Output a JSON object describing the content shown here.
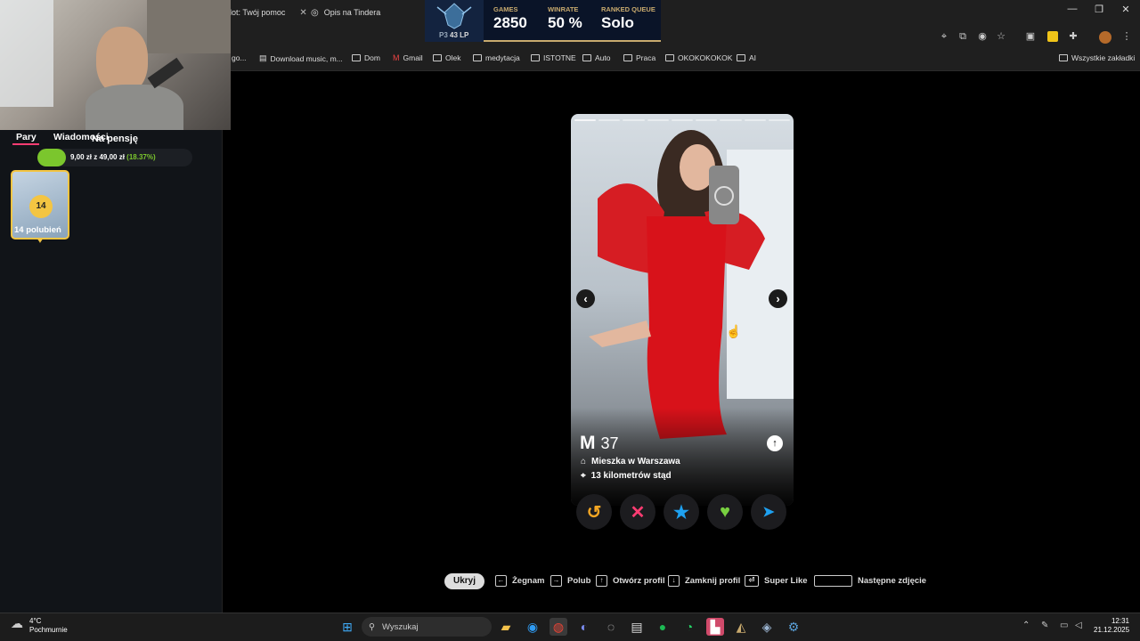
{
  "browser": {
    "tabs": [
      {
        "label": "lot: Twój pomoc"
      },
      {
        "label": "Opis na Tindera"
      }
    ],
    "bookmarks": [
      {
        "label": "go..."
      },
      {
        "label": "Download music, m..."
      },
      {
        "label": "Dom"
      },
      {
        "label": "Gmail"
      },
      {
        "label": "Olek"
      },
      {
        "label": "medytacja"
      },
      {
        "label": "ISTOTNE"
      },
      {
        "label": "Auto"
      },
      {
        "label": "Praca"
      },
      {
        "label": "OKOKOKOKOK"
      },
      {
        "label": "AI"
      }
    ],
    "all_bookmarks": "Wszystkie zakładki"
  },
  "lol": {
    "rank": "P3",
    "lp": "43 LP",
    "games_label": "GAMES",
    "games_value": "2850",
    "winrate_label": "WINRATE",
    "winrate_value": "50 %",
    "queue_label": "RANKED QUEUE",
    "queue_value": "Solo"
  },
  "sidebar": {
    "tabs": [
      {
        "label": "Pary"
      },
      {
        "label": "Wiadomości"
      }
    ],
    "goal_title": "Na pensję",
    "goal_text": "9,00 zł z 49,00 zł",
    "goal_percent_text": "(18.37%)",
    "goal_fraction": 0.1837,
    "likes_count": "14",
    "likes_label": "14 polubień"
  },
  "profile": {
    "name": "M",
    "age": "37",
    "lives": "Mieszka w Warszawa",
    "distance": "13 kilometrów stąd",
    "photo_count": 9
  },
  "actions": [
    {
      "name": "rewind-button",
      "icon": "↺",
      "color": "#f5a623"
    },
    {
      "name": "nope-button",
      "icon": "✕",
      "color": "#fe3c72"
    },
    {
      "name": "super-like-button",
      "icon": "★",
      "color": "#1ea1f1"
    },
    {
      "name": "like-button",
      "icon": "♥",
      "color": "#78d040"
    },
    {
      "name": "boost-button",
      "icon": "➤",
      "color": "#1ea1f1"
    }
  ],
  "shortcuts": {
    "hide": "Ukryj",
    "items": [
      {
        "key": "←",
        "label": "Żegnam"
      },
      {
        "key": "→",
        "label": "Polub"
      },
      {
        "key": "↑",
        "label": "Otwórz profil"
      },
      {
        "key": "↓",
        "label": "Zamknij profil"
      },
      {
        "key": "⏎",
        "label": "Super Like"
      },
      {
        "key": "",
        "label": "Następne zdjęcie"
      }
    ]
  },
  "taskbar": {
    "weather_temp": "4°C",
    "weather_desc": "Pochmurnie",
    "search": "Wyszukaj",
    "time": "12:31",
    "date": "21.12.2025"
  },
  "colors": {
    "accent": "#fe3c72",
    "gold": "#c8aa6e",
    "green": "#7bc62d"
  }
}
